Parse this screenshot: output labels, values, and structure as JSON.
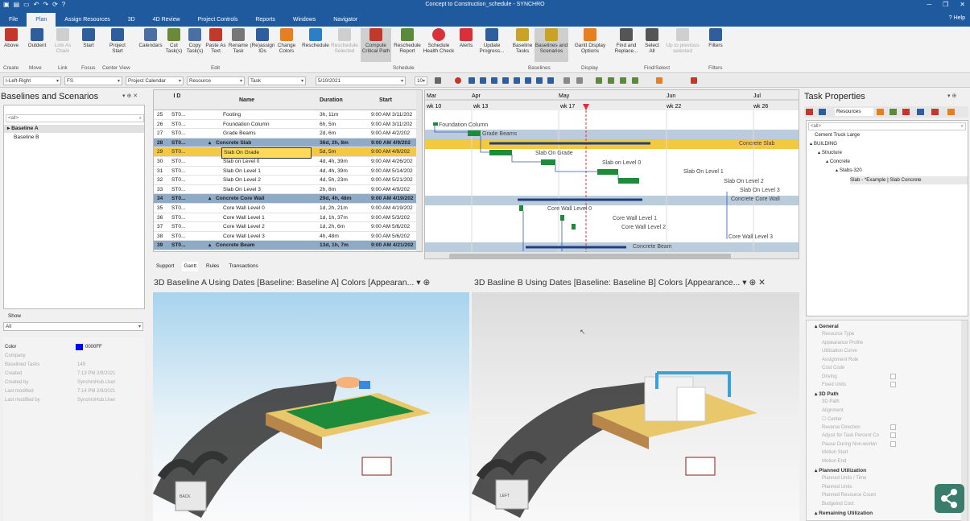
{
  "window": {
    "title": "Concept to Construction_schedule - SYNCHRO",
    "help": "Help"
  },
  "tabs": [
    "File",
    "Plan",
    "Assign Resources",
    "3D",
    "4D Review",
    "Project Controls",
    "Reports",
    "Windows",
    "Navigator"
  ],
  "ribbon": {
    "buttons": [
      {
        "label": "Above",
        "color": "#c0392b"
      },
      {
        "label": "Outdent",
        "color": "#2e5e9e"
      },
      {
        "label": "Link As Chain",
        "color": "#999999",
        "disabled": true
      },
      {
        "label": "Start",
        "color": "#2e5e9e"
      },
      {
        "label": "Project Start",
        "color": "#2e5e9e"
      },
      {
        "label": "Calendars",
        "color": "#4a6fa5"
      },
      {
        "label": "Cut Task(s)",
        "color": "#6a8a3a"
      },
      {
        "label": "Copy Task(s)",
        "color": "#4a6fa5"
      },
      {
        "label": "Paste As Text",
        "color": "#c0392b"
      },
      {
        "label": "Rename Task",
        "color": "#777777"
      },
      {
        "label": "(Re)assign IDs",
        "color": "#2e5e9e"
      },
      {
        "label": "Change Colors",
        "color": "#e67e22"
      },
      {
        "label": "Reschedule",
        "color": "#2e7ec4"
      },
      {
        "label": "Reschedule Selected",
        "color": "#999999",
        "disabled": true
      },
      {
        "label": "Compute Critical Path",
        "color": "#c0392b",
        "selected": true
      },
      {
        "label": "Reschedule Report",
        "color": "#5b8a3a"
      },
      {
        "label": "Schedule Health Check",
        "color": "#d9303a"
      },
      {
        "label": "Alerts",
        "color": "#d9303a"
      },
      {
        "label": "Update Progress...",
        "color": "#2e5e9e"
      },
      {
        "label": "Baseline Tasks",
        "color": "#c9a227"
      },
      {
        "label": "Baselines and Scenarios",
        "color": "#c9a227",
        "selected": true
      },
      {
        "label": "Gantt Display Options",
        "color": "#e67e22"
      },
      {
        "label": "Find and Replace...",
        "color": "#555555"
      },
      {
        "label": "Select All",
        "color": "#555555"
      },
      {
        "label": "Up to previous selected",
        "color": "#999999",
        "disabled": true
      },
      {
        "label": "Filters",
        "color": "#2e5e9e"
      }
    ],
    "groups": [
      "Create",
      "Move",
      "Link",
      "Focus",
      "Center View",
      "Edit",
      "Schedule",
      "Baselines",
      "Display",
      "Find/Select",
      "Filters"
    ]
  },
  "toolbar": {
    "combos": [
      "I-Left-Right",
      "FS",
      "Project Calendar",
      "Resource",
      "Task",
      "5/10/2021",
      "10"
    ]
  },
  "left_panel": {
    "title": "Baselines and Scenarios",
    "search_placeholder": "<all>",
    "items": [
      "Baseline A",
      "Baseline B"
    ],
    "show_label": "Show",
    "show_value": "All",
    "props": [
      {
        "k": "Color",
        "v": "0000FF"
      },
      {
        "k": "Company",
        "v": ""
      },
      {
        "k": "Baselined Tasks",
        "v": "149"
      },
      {
        "k": "Created",
        "v": "7:13 PM 2/9/2021"
      },
      {
        "k": "Created by",
        "v": "SynchroHub.User"
      },
      {
        "k": "Last modified",
        "v": "7:14 PM 2/9/2021"
      },
      {
        "k": "Last modified by",
        "v": "SynchroHub.User"
      }
    ],
    "color_swatch": "#0000ff"
  },
  "grid": {
    "headers": {
      "id": "I D",
      "name": "Name",
      "duration": "Duration",
      "start": "Start"
    },
    "rows": [
      {
        "num": "25",
        "id": "ST0...",
        "name": "Footing",
        "dur": "3h, 11m",
        "start": "9:00 AM 3/11/202"
      },
      {
        "num": "26",
        "id": "ST0...",
        "name": "Foundation Column",
        "dur": "6h, 5m",
        "start": "9:00 AM 3/11/202"
      },
      {
        "num": "27",
        "id": "ST0...",
        "name": "Grade Beams",
        "dur": "2d, 6m",
        "start": "9:00 AM 4/2/202"
      },
      {
        "num": "28",
        "id": "ST0...",
        "name": "Concrete Slab",
        "dur": "36d, 2h, 8m",
        "start": "9:00 AM 4/9/202",
        "summary": true
      },
      {
        "num": "29",
        "id": "ST0...",
        "name": "Slab On Grade",
        "dur": "5d, 5m",
        "start": "9:00 AM 4/9/202",
        "selected": true
      },
      {
        "num": "30",
        "id": "ST0...",
        "name": "Slab on Level 0",
        "dur": "4d, 4h, 39m",
        "start": "9:00 AM 4/26/202"
      },
      {
        "num": "31",
        "id": "ST0...",
        "name": "Slab On Level 1",
        "dur": "4d, 4h, 39m",
        "start": "9:00 AM 5/14/202"
      },
      {
        "num": "32",
        "id": "ST0...",
        "name": "Slab On Level 2",
        "dur": "4d, 5h, 23m",
        "start": "9:00 AM 5/21/202"
      },
      {
        "num": "33",
        "id": "ST0...",
        "name": "Slab On Level 3",
        "dur": "2h, 8m",
        "start": "9:00 AM 4/9/202"
      },
      {
        "num": "34",
        "id": "ST0...",
        "name": "Concrete Core Wall",
        "dur": "29d, 4h, 48m",
        "start": "9:00 AM 4/19/202",
        "summary": true
      },
      {
        "num": "35",
        "id": "ST0...",
        "name": "Core Wall Level 0",
        "dur": "1d, 2h, 21m",
        "start": "9:00 AM 4/19/202"
      },
      {
        "num": "36",
        "id": "ST0...",
        "name": "Core Wall Level 1",
        "dur": "1d, 1h, 37m",
        "start": "9:00 AM 5/3/202"
      },
      {
        "num": "37",
        "id": "ST0...",
        "name": "Core Wall Level 2",
        "dur": "1d, 2h, 6m",
        "start": "9:00 AM 5/6/202"
      },
      {
        "num": "38",
        "id": "ST0...",
        "name": "Core Wall Level 3",
        "dur": "4h, 48m",
        "start": "9:00 AM 5/6/202"
      },
      {
        "num": "39",
        "id": "ST0...",
        "name": "Concrete Beam",
        "dur": "13d, 1h, 7m",
        "start": "9:00 AM 4/21/202",
        "summary": true
      }
    ],
    "bottom_tabs": [
      "Support",
      "Gantt",
      "Rules",
      "Transactions"
    ]
  },
  "gantt": {
    "months": [
      "Mar",
      "Apr",
      "May",
      "Jun",
      "Jul"
    ],
    "weeks": [
      "wk 10",
      "wk 13",
      "wk 17",
      "wk 22",
      "wk 26"
    ],
    "bar_labels": [
      "Foundation Column",
      "Grade Beams",
      "Slab On Grade",
      "Concrete Slab",
      "Slab on Level 0",
      "Slab On Level 1",
      "Slab On Level 2",
      "Slab On Level 3",
      "Concrete Core Wall",
      "Core Wall Level 0",
      "Core Wall Level 1",
      "Core Wall Level 2",
      "Core Wall Level 3",
      "Concrete Beam"
    ]
  },
  "views": {
    "a_title": "3D Baseline A Using Dates [Baseline: Baseline A] Colors [Appearan...",
    "b_title": "3D Basline B Using Dates [Baseline: Baseline B] Colors [Appearance...",
    "cube_a": "BACK",
    "cube_b": "LEFT"
  },
  "right_panel": {
    "title": "Task Properties",
    "resources_tab": "Resources",
    "search_placeholder": "<all>",
    "tree": [
      "Cement Truck Large",
      "BUILDING",
      "Structure",
      "Concrete",
      "Slabs-320",
      "Slab - *Example | Slab Concrete"
    ],
    "sections": [
      {
        "title": "General",
        "props": [
          "Resource Type",
          "Appearance Profile",
          "Utilization Curve",
          "Assignment Rule",
          "Cost Code",
          "Driving",
          "Fixed Units"
        ]
      },
      {
        "title": "3D Path",
        "props": [
          "3D Path",
          "Alignment",
          "Center",
          "Reverse Direction",
          "Adjust for Task Percent Co",
          "Pause During Non-workin",
          "Motion Start",
          "Motion End"
        ]
      },
      {
        "title": "Planned Utilization",
        "props": [
          "Planned Units / Time",
          "Planned Units",
          "Planned Resource Count",
          "Budgeted Cost"
        ]
      },
      {
        "title": "Remaining Utilization",
        "props": []
      }
    ]
  }
}
